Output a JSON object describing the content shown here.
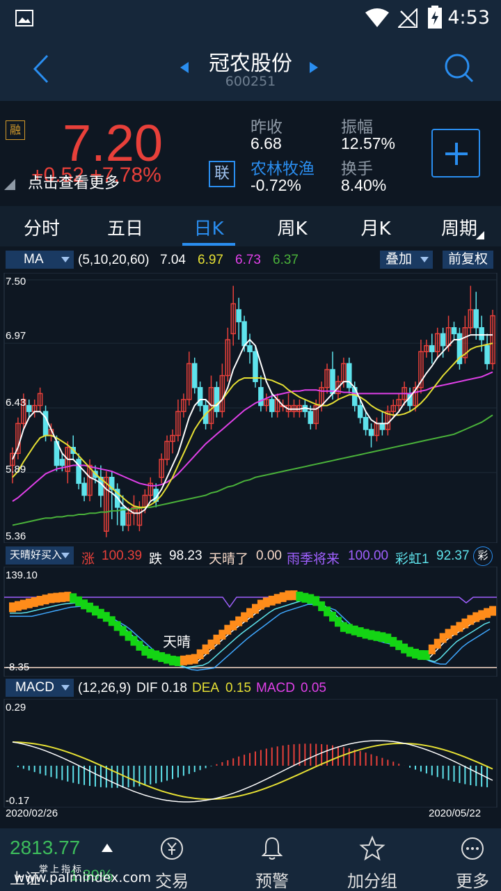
{
  "status_bar": {
    "time": "4:53"
  },
  "header": {
    "stock_name": "冠农股份",
    "stock_code": "600251"
  },
  "quote": {
    "badge": "融",
    "price": "7.20",
    "change": "+0.52  +7.78%",
    "hint": "点击查看更多",
    "link_badge": "联",
    "prev_close_label": "昨收",
    "prev_close_value": "6.68",
    "sector_label": "农林牧渔",
    "sector_value": "-0.72%",
    "amplitude_label": "振幅",
    "amplitude_value": "12.57%",
    "turnover_label": "换手",
    "turnover_value": "8.40%"
  },
  "tabs": [
    {
      "label": "分时"
    },
    {
      "label": "五日"
    },
    {
      "label": "日K"
    },
    {
      "label": "周K"
    },
    {
      "label": "月K"
    },
    {
      "label": "周期"
    }
  ],
  "ma_row": {
    "selector": "MA",
    "params": "(5,10,20,60)",
    "v5": "7.04",
    "v10": "6.97",
    "v20": "6.73",
    "v60": "6.37",
    "overlay_btn": "叠加",
    "adjust_btn": "前复权"
  },
  "price_axis": {
    "top": "7.50",
    "l2": "6.97",
    "l3": "6.43",
    "l4": "5.89",
    "bottom": "5.36"
  },
  "tq_row": {
    "selector": "天晴好买入",
    "zhang_label": "涨",
    "zhang_val": "100.39",
    "die_label": "跌",
    "die_val": "98.23",
    "tql_label": "天晴了",
    "tql_val": "0.00",
    "yj_label": "雨季将来",
    "yj_val": "100.00",
    "ch_label": "彩虹1",
    "ch_val": "92.37",
    "icon_char": "彩"
  },
  "tq_axis": {
    "top": "139.10",
    "bottom": "-8.35",
    "annotation": "天晴"
  },
  "macd_row": {
    "selector": "MACD",
    "params": "(12,26,9)",
    "dif_label": "DIF",
    "dif_val": "0.18",
    "dea_label": "DEA",
    "dea_val": "0.15",
    "macd_label": "MACD",
    "macd_val": "0.05"
  },
  "macd_axis": {
    "top": "0.29",
    "bottom": "-0.17"
  },
  "dates": {
    "start": "2020/02/26",
    "end": "2020/05/22"
  },
  "bottom_nav": {
    "index_value": "2813.77",
    "index_name": "上证",
    "index_change": "1.89%",
    "watermark_top": "掌上指标",
    "watermark": "www.palmindex.com",
    "trade": "交易",
    "alert": "预警",
    "watchlist": "加分组",
    "more": "更多"
  },
  "colors": {
    "up": "#e8403a",
    "down": "#5ee3ec",
    "ma5": "#ffffff",
    "ma10": "#e6e034",
    "ma20": "#e040e8",
    "ma60": "#4ab23a",
    "accent": "#2a8ef0"
  },
  "chart_data": {
    "type": "candlestick",
    "ylim": [
      5.36,
      7.5
    ],
    "candles": [
      [
        5.95,
        6.05,
        5.8,
        6.1
      ],
      [
        6.05,
        6.3,
        6.0,
        6.35
      ],
      [
        6.3,
        6.5,
        6.25,
        6.55
      ],
      [
        6.45,
        6.4,
        6.35,
        6.5
      ],
      [
        6.4,
        6.45,
        6.35,
        6.5
      ],
      [
        6.45,
        6.55,
        6.4,
        6.6
      ],
      [
        6.4,
        6.2,
        6.15,
        6.45
      ],
      [
        6.2,
        6.25,
        6.15,
        6.3
      ],
      [
        6.15,
        5.95,
        5.9,
        6.2
      ],
      [
        6.0,
        5.95,
        5.9,
        6.05
      ],
      [
        5.9,
        6.1,
        5.8,
        6.15
      ],
      [
        6.1,
        6.05,
        6.0,
        6.2
      ],
      [
        6.0,
        5.8,
        5.75,
        6.05
      ],
      [
        5.8,
        5.7,
        5.65,
        5.85
      ],
      [
        5.7,
        5.95,
        5.65,
        6.0
      ],
      [
        5.9,
        5.85,
        5.8,
        5.95
      ],
      [
        5.85,
        5.7,
        5.6,
        5.95
      ],
      [
        5.4,
        5.85,
        5.35,
        5.9
      ],
      [
        5.85,
        5.75,
        5.5,
        5.9
      ],
      [
        5.75,
        5.6,
        5.45,
        5.8
      ],
      [
        5.6,
        5.45,
        5.4,
        5.7
      ],
      [
        5.45,
        5.55,
        5.4,
        5.6
      ],
      [
        5.55,
        5.6,
        5.45,
        5.7
      ],
      [
        5.45,
        5.6,
        5.4,
        5.65
      ],
      [
        5.6,
        5.7,
        5.55,
        5.75
      ],
      [
        5.7,
        5.8,
        5.65,
        5.85
      ],
      [
        5.75,
        5.65,
        5.6,
        5.8
      ],
      [
        5.85,
        6.0,
        5.8,
        6.05
      ],
      [
        6.0,
        6.15,
        5.95,
        6.2
      ],
      [
        6.15,
        6.2,
        6.05,
        6.25
      ],
      [
        6.2,
        6.4,
        6.15,
        6.5
      ],
      [
        6.4,
        6.5,
        6.35,
        6.55
      ],
      [
        6.5,
        6.8,
        6.45,
        6.9
      ],
      [
        6.8,
        6.6,
        6.55,
        6.85
      ],
      [
        6.6,
        6.45,
        6.4,
        6.65
      ],
      [
        6.45,
        6.3,
        6.25,
        6.5
      ],
      [
        6.3,
        6.6,
        6.25,
        6.7
      ],
      [
        6.6,
        6.4,
        6.35,
        6.65
      ],
      [
        6.4,
        6.7,
        6.35,
        6.8
      ],
      [
        6.7,
        7.0,
        6.65,
        7.1
      ],
      [
        7.05,
        7.3,
        6.95,
        7.45
      ],
      [
        7.25,
        7.15,
        7.0,
        7.35
      ],
      [
        7.15,
        6.95,
        6.9,
        7.2
      ],
      [
        6.95,
        6.9,
        6.8,
        7.05
      ],
      [
        6.9,
        6.65,
        6.6,
        6.95
      ],
      [
        6.6,
        6.45,
        6.4,
        6.7
      ],
      [
        6.45,
        6.5,
        6.4,
        6.55
      ],
      [
        6.5,
        6.4,
        6.35,
        6.55
      ],
      [
        6.4,
        6.5,
        6.35,
        6.55
      ],
      [
        6.45,
        6.45,
        6.4,
        6.5
      ],
      [
        6.4,
        6.45,
        6.35,
        6.55
      ],
      [
        6.4,
        6.45,
        6.35,
        6.5
      ],
      [
        6.4,
        6.45,
        6.35,
        6.5
      ],
      [
        6.45,
        6.4,
        6.35,
        6.5
      ],
      [
        6.4,
        6.3,
        6.25,
        6.45
      ],
      [
        6.3,
        6.45,
        6.25,
        6.5
      ],
      [
        6.45,
        6.6,
        6.4,
        6.65
      ],
      [
        6.6,
        6.75,
        6.55,
        6.8
      ],
      [
        6.75,
        6.55,
        6.5,
        6.9
      ],
      [
        6.55,
        6.65,
        6.5,
        6.7
      ],
      [
        6.65,
        6.8,
        6.6,
        6.85
      ],
      [
        6.8,
        6.6,
        6.55,
        6.85
      ],
      [
        6.6,
        6.45,
        6.4,
        6.65
      ],
      [
        6.45,
        6.35,
        6.3,
        6.5
      ],
      [
        6.35,
        6.25,
        6.2,
        6.4
      ],
      [
        6.25,
        6.2,
        6.1,
        6.3
      ],
      [
        6.2,
        6.3,
        6.15,
        6.35
      ],
      [
        6.3,
        6.25,
        6.2,
        6.4
      ],
      [
        6.25,
        6.4,
        6.2,
        6.45
      ],
      [
        6.4,
        6.45,
        6.35,
        6.5
      ],
      [
        6.45,
        6.5,
        6.4,
        6.55
      ],
      [
        6.5,
        6.6,
        6.45,
        6.65
      ],
      [
        6.55,
        6.45,
        6.4,
        6.6
      ],
      [
        6.45,
        6.6,
        6.4,
        6.65
      ],
      [
        6.6,
        6.9,
        6.55,
        7.0
      ],
      [
        6.9,
        6.95,
        6.85,
        7.0
      ],
      [
        6.95,
        6.9,
        6.8,
        7.05
      ],
      [
        6.9,
        7.05,
        6.85,
        7.1
      ],
      [
        7.05,
        6.95,
        6.85,
        7.1
      ],
      [
        6.95,
        7.1,
        6.9,
        7.2
      ],
      [
        7.1,
        7.05,
        7.0,
        7.15
      ],
      [
        7.05,
        6.8,
        6.75,
        7.1
      ],
      [
        6.85,
        7.1,
        6.8,
        7.2
      ],
      [
        7.1,
        7.25,
        7.05,
        7.45
      ],
      [
        7.25,
        7.1,
        7.0,
        7.4
      ],
      [
        7.1,
        7.0,
        6.9,
        7.2
      ],
      [
        6.95,
        6.8,
        6.75,
        7.05
      ],
      [
        6.8,
        7.2,
        6.75,
        7.25
      ]
    ],
    "ma5": [
      6.0,
      6.1,
      6.25,
      6.35,
      6.4,
      6.4,
      6.35,
      6.25,
      6.15,
      6.05,
      6.0,
      6.0,
      5.95,
      5.9,
      5.85,
      5.83,
      5.8,
      5.75,
      5.72,
      5.68,
      5.62,
      5.58,
      5.55,
      5.55,
      5.58,
      5.65,
      5.68,
      5.75,
      5.85,
      5.95,
      6.05,
      6.2,
      6.35,
      6.45,
      6.5,
      6.5,
      6.45,
      6.45,
      6.5,
      6.6,
      6.75,
      6.85,
      6.95,
      7.0,
      6.95,
      6.8,
      6.65,
      6.55,
      6.5,
      6.45,
      6.42,
      6.42,
      6.42,
      6.43,
      6.42,
      6.42,
      6.45,
      6.5,
      6.55,
      6.6,
      6.65,
      6.65,
      6.6,
      6.5,
      6.4,
      6.33,
      6.3,
      6.3,
      6.3,
      6.35,
      6.4,
      6.47,
      6.52,
      6.58,
      6.65,
      6.72,
      6.78,
      6.85,
      6.9,
      6.95,
      7.0,
      7.0,
      7.02,
      7.04,
      7.04,
      7.04,
      7.04,
      7.04
    ],
    "ma10": [
      5.85,
      5.9,
      5.98,
      6.05,
      6.12,
      6.18,
      6.2,
      6.2,
      6.18,
      6.15,
      6.12,
      6.08,
      6.03,
      5.98,
      5.93,
      5.88,
      5.84,
      5.8,
      5.76,
      5.72,
      5.68,
      5.64,
      5.61,
      5.6,
      5.6,
      5.62,
      5.65,
      5.7,
      5.77,
      5.85,
      5.95,
      6.05,
      6.15,
      6.25,
      6.32,
      6.38,
      6.42,
      6.46,
      6.5,
      6.56,
      6.62,
      6.66,
      6.68,
      6.68,
      6.68,
      6.68,
      6.67,
      6.66,
      6.64,
      6.62,
      6.58,
      6.55,
      6.52,
      6.5,
      6.48,
      6.46,
      6.45,
      6.45,
      6.47,
      6.5,
      6.52,
      6.54,
      6.54,
      6.52,
      6.49,
      6.45,
      6.42,
      6.4,
      6.38,
      6.37,
      6.37,
      6.38,
      6.4,
      6.43,
      6.47,
      6.52,
      6.58,
      6.64,
      6.7,
      6.75,
      6.8,
      6.85,
      6.88,
      6.92,
      6.94,
      6.95,
      6.96,
      6.97
    ],
    "ma20": [
      5.65,
      5.68,
      5.72,
      5.76,
      5.8,
      5.84,
      5.88,
      5.9,
      5.92,
      5.93,
      5.94,
      5.95,
      5.95,
      5.95,
      5.94,
      5.93,
      5.92,
      5.91,
      5.9,
      5.88,
      5.86,
      5.84,
      5.82,
      5.8,
      5.79,
      5.78,
      5.78,
      5.79,
      5.81,
      5.84,
      5.88,
      5.93,
      5.98,
      6.03,
      6.08,
      6.13,
      6.17,
      6.21,
      6.25,
      6.29,
      6.33,
      6.37,
      6.41,
      6.44,
      6.47,
      6.49,
      6.51,
      6.53,
      6.54,
      6.55,
      6.56,
      6.57,
      6.57,
      6.58,
      6.58,
      6.58,
      6.57,
      6.57,
      6.57,
      6.57,
      6.56,
      6.56,
      6.55,
      6.55,
      6.55,
      6.55,
      6.55,
      6.55,
      6.55,
      6.55,
      6.55,
      6.55,
      6.55,
      6.56,
      6.57,
      6.58,
      6.6,
      6.61,
      6.62,
      6.63,
      6.64,
      6.65,
      6.66,
      6.67,
      6.68,
      6.69,
      6.71,
      6.73
    ],
    "ma60": [
      5.45,
      5.46,
      5.47,
      5.48,
      5.49,
      5.5,
      5.51,
      5.51,
      5.52,
      5.52,
      5.53,
      5.53,
      5.54,
      5.54,
      5.55,
      5.55,
      5.56,
      5.56,
      5.57,
      5.57,
      5.58,
      5.58,
      5.59,
      5.59,
      5.6,
      5.6,
      5.61,
      5.62,
      5.63,
      5.64,
      5.65,
      5.66,
      5.67,
      5.68,
      5.69,
      5.7,
      5.72,
      5.73,
      5.75,
      5.77,
      5.78,
      5.8,
      5.82,
      5.83,
      5.85,
      5.86,
      5.87,
      5.88,
      5.89,
      5.9,
      5.91,
      5.92,
      5.93,
      5.94,
      5.95,
      5.96,
      5.97,
      5.98,
      5.99,
      6.0,
      6.01,
      6.02,
      6.03,
      6.04,
      6.05,
      6.06,
      6.07,
      6.08,
      6.09,
      6.1,
      6.11,
      6.12,
      6.13,
      6.14,
      6.15,
      6.16,
      6.17,
      6.18,
      6.19,
      6.2,
      6.21,
      6.23,
      6.25,
      6.27,
      6.29,
      6.31,
      6.34,
      6.37
    ]
  }
}
